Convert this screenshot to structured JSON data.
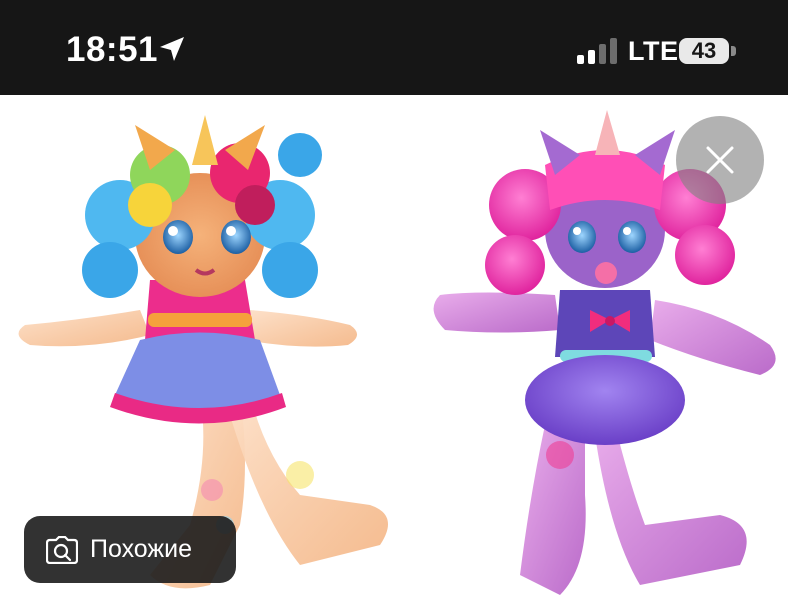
{
  "status_bar": {
    "time": "18:51",
    "location_icon": "location-arrow-icon",
    "signal_icon": "cellular-signal-icon",
    "network": "LTE",
    "battery_level": "43"
  },
  "image_viewer": {
    "close_icon": "close-icon",
    "similar_button": {
      "label": "Похожие",
      "icon": "camera-search-icon"
    }
  },
  "colors": {
    "status_bar_bg": "#161616",
    "overlay_button_bg": "#1c1c1c",
    "close_button_bg": "#828282"
  }
}
